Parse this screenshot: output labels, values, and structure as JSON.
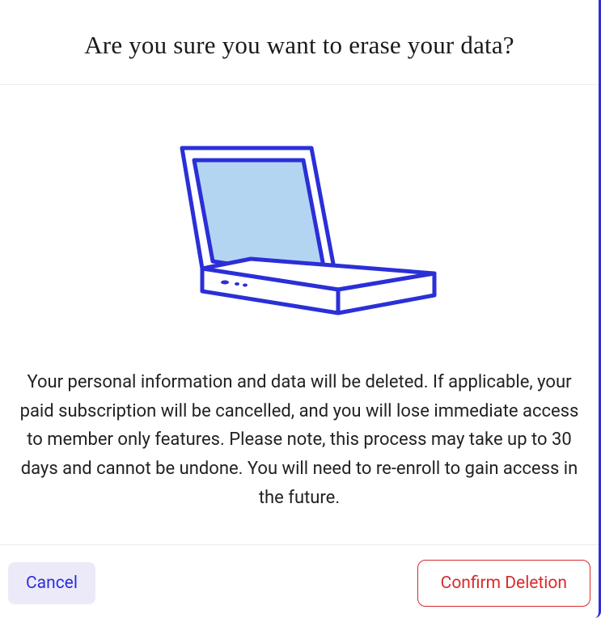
{
  "dialog": {
    "title": "Are you sure you want to erase your data?",
    "description": "Your personal information and data will be deleted. If applicable, your paid subscription will be cancelled, and you will lose immediate access to member only features. Please note, this process may take up to 30 days and cannot be undone. You will need to re-enroll to gain access in the future.",
    "cancel_label": "Cancel",
    "confirm_label": "Confirm Deletion"
  }
}
